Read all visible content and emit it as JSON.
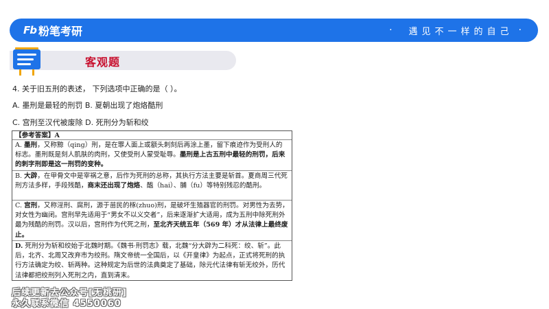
{
  "banner": {
    "brand_logo": "Fb",
    "brand_name": "粉笔考研",
    "slogan": "遇见不一样的自己",
    "slogan_dot": "·"
  },
  "section": {
    "title": "客观题"
  },
  "question": {
    "stem": "4. 关于旧五刑的表述， 下列选项中正确的是（ ）。",
    "line1": "A. 墨刑是最轻的刑罚  B. 夏朝出现了炮烙酷刑",
    "line2": "C. 宫刑至汉代被废除  D. 死刑分为斩和绞"
  },
  "answer": {
    "header": "【参考答案】A",
    "a": {
      "prefix": "A. ",
      "term": "墨刑",
      "text1": "，又称黥（qing）刑，是在罪人面上或额头刺刻后再涂上墨，留下痕迹作为受刑人的标志。墨刑既是刻人肌肤的肉刑，又使受刑人蒙受耻辱。",
      "strong": "墨刑是上古五刑中最轻的刑罚，后来的刺字刑即是这一刑罚的变种。"
    },
    "b": {
      "prefix": "B. ",
      "term": "大辟",
      "text1": "，在甲骨文中是宰祸之意，后作为死刑的总称，其执行方法主要是斩首。夏商周三代死刑方法多样，手段残酷，",
      "strong": "商末还出现了炮烙",
      "text2": "、醢（hai）、脯（fu）等特别残忍的酷刑。"
    },
    "c": {
      "prefix": "C. ",
      "term": "宫刑",
      "text1": "，又称淫刑、腐刑，源于苗民的椓(zhuo)刑，是破坏生殖器官的刑罚。对男性为去势，对女性为幽闭。宫刑早先适用于“男女不以义交者”，后来逐渐扩大适用，成为五刑中除死刑外最为残酷的刑罚。汉以后，宫刑作为代死之刑，",
      "strong": "至北齐天统五年（569 年）才从法律上最终废止。"
    },
    "d": {
      "prefix": "D.",
      "text1": " 死刑分为斩和绞始于北魏时期。《魏书·刑罚志》载，北魏“分大辟为二科死：绞、斩”。此后，北齐、北周又改弃市为绞刑。隋文帝统一全国后，以《开皇律》为起点，正式将死刑的执行方法确定为绞、斩两种。这种规定为后世的法典奠定了基础，除元代法律有斩无绞外，历代法律都把绞刑列入死刑之内，直到清末。"
    }
  },
  "watermark": {
    "line1": "后续更新去公众号[无桃研]",
    "line2": "永久联系微信 4550060"
  },
  "colors": {
    "banner_blue": "#1e73e8",
    "title_red": "#c8102e",
    "section_bar": "#e9e9ef"
  }
}
